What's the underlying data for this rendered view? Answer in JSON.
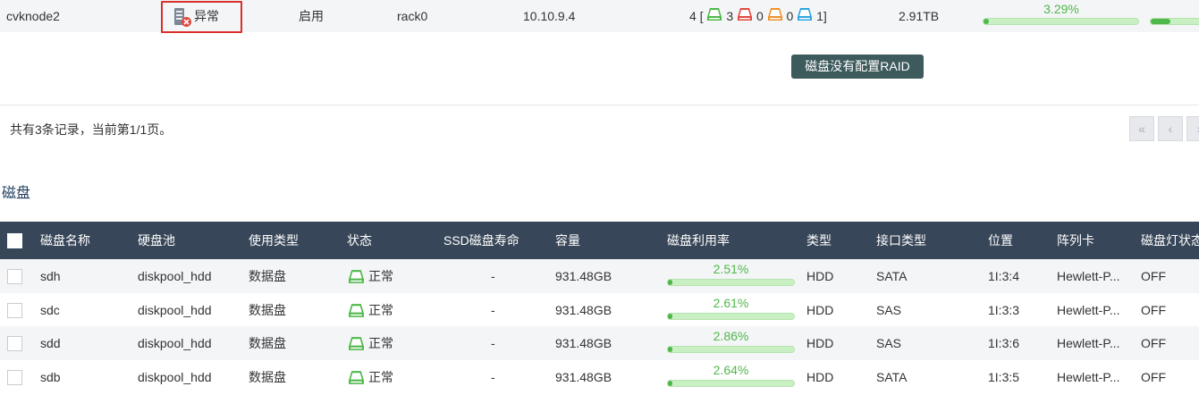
{
  "host": {
    "name": "cvknode2",
    "status": "异常",
    "state": "启用",
    "rack": "rack0",
    "ip": "10.10.9.4",
    "disk_summary": {
      "prefix": "4 [",
      "normal": "3",
      "error": "0",
      "warning": "0",
      "ssd": "1",
      "suffix": "]"
    },
    "capacity": "2.91TB",
    "usage_pct": "3.29%",
    "usage_fraction": 0.0329
  },
  "tooltip": "磁盘没有配置RAID",
  "pagination": {
    "summary": "共有3条记录，当前第1/1页。",
    "first": "«",
    "prev": "‹",
    "next": "›"
  },
  "disk_section": {
    "title": "磁盘",
    "columns": [
      "磁盘名称",
      "硬盘池",
      "使用类型",
      "状态",
      "SSD磁盘寿命",
      "容量",
      "磁盘利用率",
      "类型",
      "接口类型",
      "位置",
      "阵列卡",
      "磁盘灯状态"
    ],
    "rows": [
      {
        "name": "sdh",
        "pool": "diskpool_hdd",
        "usage": "数据盘",
        "status": "正常",
        "ssd_life": "-",
        "capacity": "931.48GB",
        "util": "2.51%",
        "util_fraction": 0.0251,
        "type": "HDD",
        "interface": "SATA",
        "location": "1I:3:4",
        "raid": "Hewlett-P...",
        "led": "OFF"
      },
      {
        "name": "sdc",
        "pool": "diskpool_hdd",
        "usage": "数据盘",
        "status": "正常",
        "ssd_life": "-",
        "capacity": "931.48GB",
        "util": "2.61%",
        "util_fraction": 0.0261,
        "type": "HDD",
        "interface": "SAS",
        "location": "1I:3:3",
        "raid": "Hewlett-P...",
        "led": "OFF"
      },
      {
        "name": "sdd",
        "pool": "diskpool_hdd",
        "usage": "数据盘",
        "status": "正常",
        "ssd_life": "-",
        "capacity": "931.48GB",
        "util": "2.86%",
        "util_fraction": 0.0286,
        "type": "HDD",
        "interface": "SAS",
        "location": "1I:3:6",
        "raid": "Hewlett-P...",
        "led": "OFF"
      },
      {
        "name": "sdb",
        "pool": "diskpool_hdd",
        "usage": "数据盘",
        "status": "正常",
        "ssd_life": "-",
        "capacity": "931.48GB",
        "util": "2.64%",
        "util_fraction": 0.0264,
        "type": "HDD",
        "interface": "SATA",
        "location": "1I:3:5",
        "raid": "Hewlett-P...",
        "led": "OFF"
      }
    ]
  },
  "colors": {
    "header_bg": "#374658",
    "ok_green": "#4fb84a",
    "error_red": "#e2483f",
    "warn_orange": "#f0922b",
    "ssd_blue": "#2fa3e0",
    "tooltip_bg": "#3d5a5c"
  },
  "icons": {
    "host_status": "server-error-icon",
    "disk_normal": "disk-green-icon",
    "disk_error": "disk-red-icon",
    "disk_warning": "disk-orange-icon",
    "disk_ssd": "disk-blue-icon"
  }
}
